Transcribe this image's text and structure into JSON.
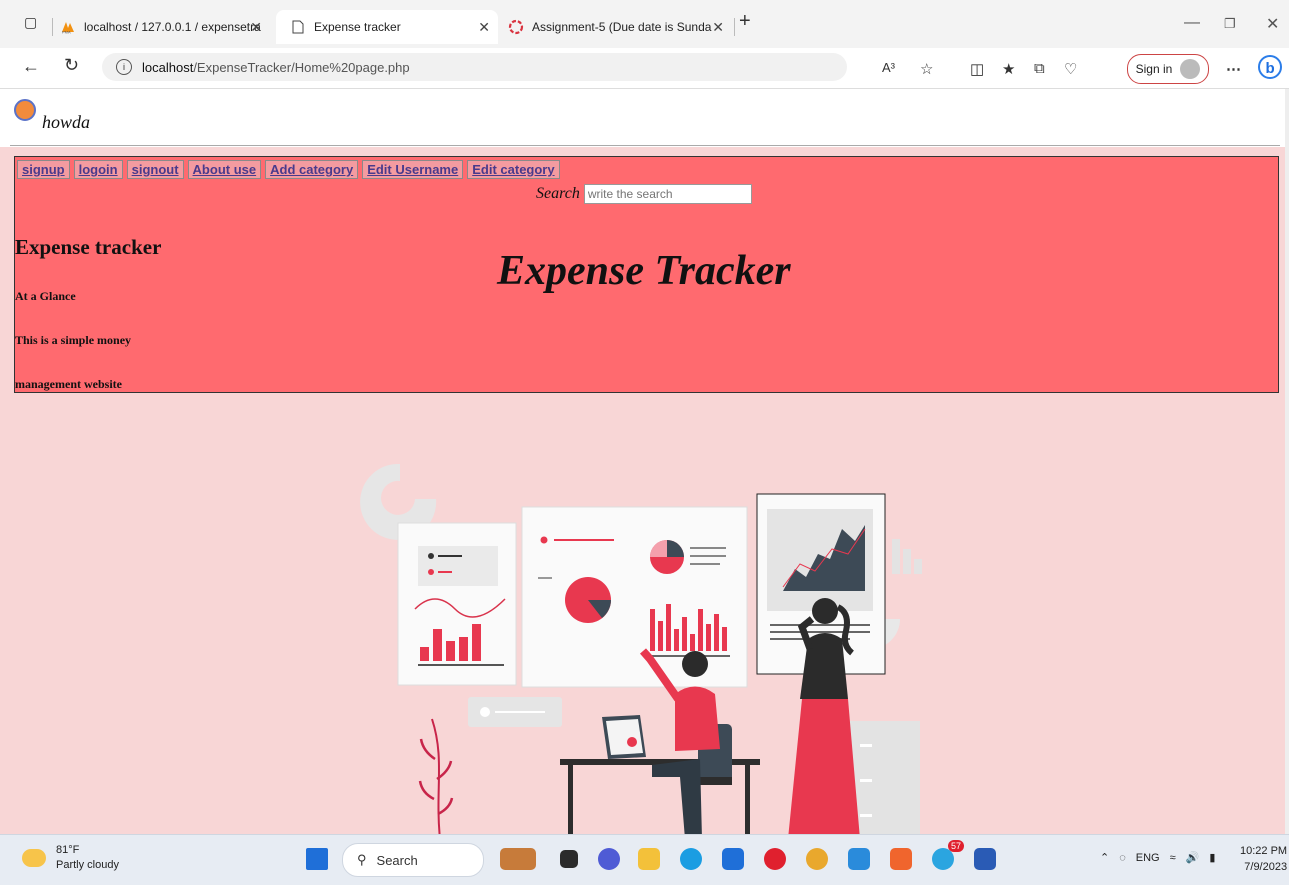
{
  "browser": {
    "tabs": [
      {
        "label": "localhost / 127.0.0.1 / expensetra",
        "active": false
      },
      {
        "label": "Expense tracker",
        "active": true
      },
      {
        "label": "Assignment-5 (Due date is Sunda",
        "active": false
      }
    ],
    "url_host": "localhost",
    "url_path": "/ExpenseTracker/Home%20page.php",
    "sign_in_label": "Sign in",
    "read_aloud_label": "A³"
  },
  "page": {
    "username": "howda",
    "menu": [
      "signup",
      "logoin",
      "signout",
      "About use",
      "Add category",
      "Edit Username",
      "Edit category"
    ],
    "search": {
      "label": "Search",
      "placeholder": "write the search"
    },
    "heading": "Expense tracker",
    "at_a_glance": "At a Glance",
    "desc_line1": "This is a simple money",
    "desc_line2": "management website",
    "title": "Expense Tracker"
  },
  "taskbar": {
    "temp": "81°F",
    "weather": "Partly cloudy",
    "search_label": "Search",
    "badge": "57",
    "lang": "ENG",
    "time": "10:22 PM",
    "date": "7/9/2023"
  },
  "colors": {
    "header_bg": "#ff6a6f",
    "page_bg": "#f8d6d6",
    "accent_red": "#e8384f",
    "dark_slate": "#3d4a56"
  }
}
